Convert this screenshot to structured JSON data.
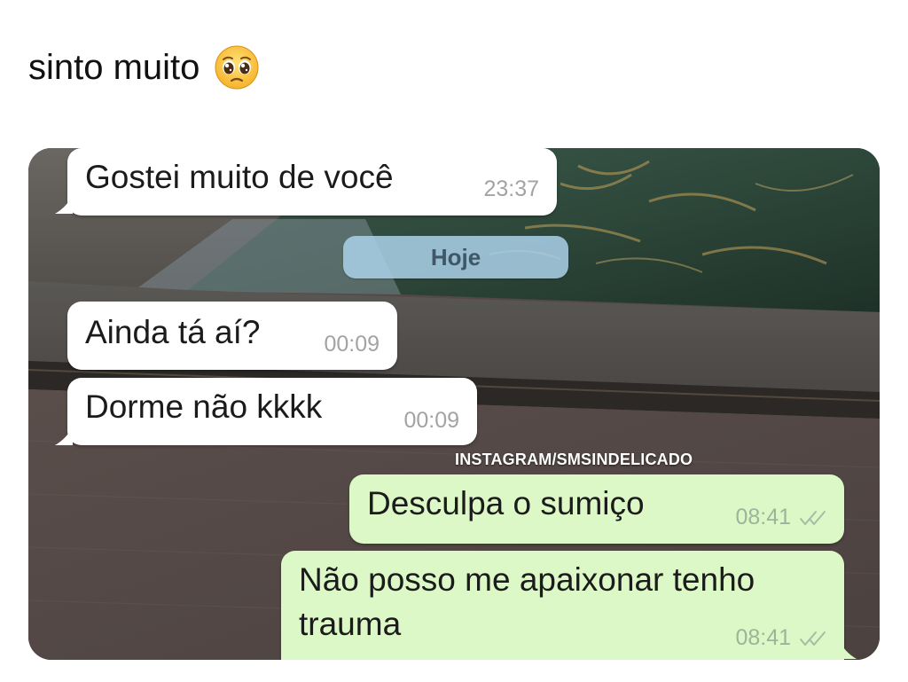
{
  "post": {
    "text": "sinto muito",
    "emoji": "pleading-face-emoji"
  },
  "chat": {
    "date_divider": "Hoje",
    "watermark": "INSTAGRAM/SMSINDELICADO",
    "messages": [
      {
        "direction": "incoming",
        "text": "Gostei muito de você",
        "time": "23:37"
      },
      {
        "direction": "incoming",
        "text": "Ainda tá aí?",
        "time": "00:09"
      },
      {
        "direction": "incoming",
        "text": "Dorme não kkkk",
        "time": "00:09"
      },
      {
        "direction": "outgoing",
        "text": "Desculpa o sumiço",
        "time": "08:41",
        "status": "read-double-check-icon"
      },
      {
        "direction": "outgoing",
        "text": "Não posso me apaixonar tenho trauma",
        "time": "08:41",
        "status": "read-double-check-icon"
      }
    ]
  },
  "colors": {
    "incoming_bubble": "#ffffff",
    "outgoing_bubble": "#dcf8c6",
    "date_chip": "#aad0e8"
  }
}
